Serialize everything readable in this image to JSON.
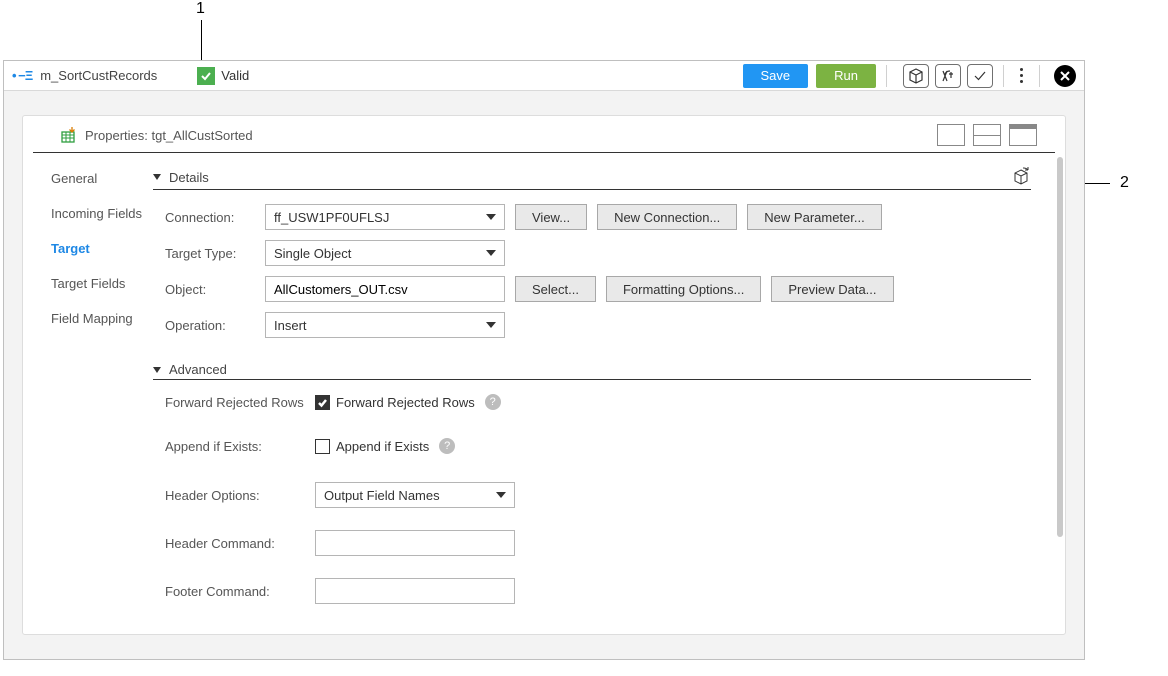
{
  "callouts": {
    "one": "1",
    "two": "2"
  },
  "titlebar": {
    "doc_name": "m_SortCustRecords",
    "valid_label": "Valid",
    "save_label": "Save",
    "run_label": "Run"
  },
  "panel": {
    "title": "Properties: tgt_AllCustSorted"
  },
  "tabs": {
    "general": "General",
    "incoming": "Incoming Fields",
    "target": "Target",
    "target_fields": "Target Fields",
    "field_mapping": "Field Mapping"
  },
  "sections": {
    "details": "Details",
    "advanced": "Advanced"
  },
  "details": {
    "connection_label": "Connection:",
    "connection_value": "ff_USW1PF0UFLSJ",
    "view_btn": "View...",
    "new_conn_btn": "New Connection...",
    "new_param_btn": "New Parameter...",
    "target_type_label": "Target Type:",
    "target_type_value": "Single Object",
    "object_label": "Object:",
    "object_value": "AllCustomers_OUT.csv",
    "select_btn": "Select...",
    "formatting_btn": "Formatting Options...",
    "preview_btn": "Preview Data...",
    "operation_label": "Operation:",
    "operation_value": "Insert"
  },
  "advanced": {
    "frr_label": "Forward Rejected Rows",
    "frr_check_label": "Forward Rejected Rows",
    "append_label": "Append if Exists:",
    "append_check_label": "Append if Exists",
    "header_options_label": "Header Options:",
    "header_options_value": "Output Field Names",
    "header_command_label": "Header Command:",
    "header_command_value": "",
    "footer_command_label": "Footer Command:",
    "footer_command_value": ""
  }
}
